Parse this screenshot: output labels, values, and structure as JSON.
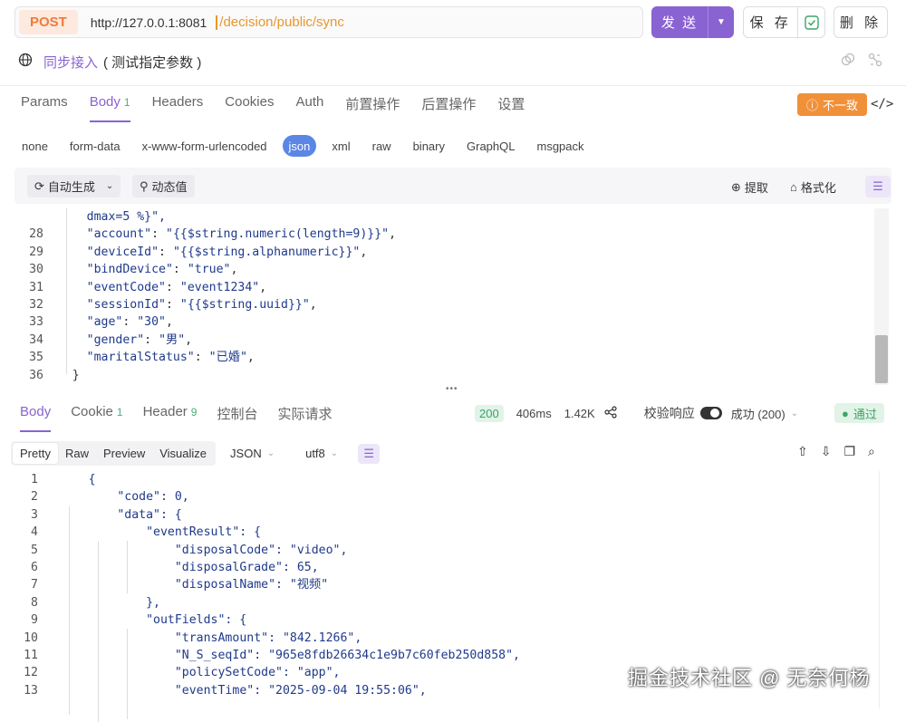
{
  "request": {
    "method": "POST",
    "url_host": "http://127.0.0.1:8081",
    "url_path": "/decision/public/sync",
    "send_label": "发 送",
    "save_label": "保 存",
    "delete_label": "删 除"
  },
  "title": {
    "name": "同步接入",
    "suffix": "( 测试指定参数 )"
  },
  "req_tabs": {
    "params": "Params",
    "body": "Body",
    "body_count": "1",
    "headers": "Headers",
    "cookies": "Cookies",
    "auth": "Auth",
    "pre": "前置操作",
    "post": "后置操作",
    "settings": "设置",
    "mismatch": "不一致"
  },
  "body_types": [
    "none",
    "form-data",
    "x-www-form-urlencoded",
    "json",
    "xml",
    "raw",
    "binary",
    "GraphQL",
    "msgpack"
  ],
  "body_type_active": "json",
  "editor_toolbar": {
    "auto": "自动生成",
    "dynamic": "动态值",
    "extract": "提取",
    "format": "格式化"
  },
  "request_body": {
    "partial": "dmax=5 %}\",",
    "lines": [
      {
        "n": "28",
        "key": "\"account\"",
        "val": "\"{{$string.numeric(length=9)}}\""
      },
      {
        "n": "29",
        "key": "\"deviceId\"",
        "val": "\"{{$string.alphanumeric}}\""
      },
      {
        "n": "30",
        "key": "\"bindDevice\"",
        "val": "\"true\""
      },
      {
        "n": "31",
        "key": "\"eventCode\"",
        "val": "\"event1234\""
      },
      {
        "n": "32",
        "key": "\"sessionId\"",
        "val": "\"{{$string.uuid}}\""
      },
      {
        "n": "33",
        "key": "\"age\"",
        "val": "\"30\""
      },
      {
        "n": "34",
        "key": "\"gender\"",
        "val": "\"男\""
      },
      {
        "n": "35",
        "key": "\"maritalStatus\"",
        "val": "\"已婚\""
      }
    ],
    "last_n": "36",
    "last": "}"
  },
  "res_tabs": {
    "body": "Body",
    "cookie": "Cookie",
    "cookie_count": "1",
    "header": "Header",
    "header_count": "9",
    "console": "控制台",
    "actual": "实际请求"
  },
  "res_status": {
    "code": "200",
    "time": "406ms",
    "size": "1.42K",
    "validate": "校验响应",
    "result": "成功 (200)",
    "pass": "通过"
  },
  "view_modes": {
    "pretty": "Pretty",
    "raw": "Raw",
    "preview": "Preview",
    "visualize": "Visualize",
    "format": "JSON",
    "encoding": "utf8"
  },
  "response_body": [
    {
      "n": "1",
      "t": "{"
    },
    {
      "n": "2",
      "t": "\"code\": 0,"
    },
    {
      "n": "3",
      "t": "\"data\": {"
    },
    {
      "n": "4",
      "t": "\"eventResult\": {"
    },
    {
      "n": "5",
      "t": "\"disposalCode\": \"video\","
    },
    {
      "n": "6",
      "t": "\"disposalGrade\": 65,"
    },
    {
      "n": "7",
      "t": "\"disposalName\": \"视频\""
    },
    {
      "n": "8",
      "t": "},"
    },
    {
      "n": "9",
      "t": "\"outFields\": {"
    },
    {
      "n": "10",
      "t": "\"transAmount\": \"842.1266\","
    },
    {
      "n": "11",
      "t": "\"N_S_seqId\": \"965e8fdb26634c1e9b7c60feb250d858\","
    },
    {
      "n": "12",
      "t": "\"policySetCode\": \"app\","
    },
    {
      "n": "13",
      "t": "\"eventTime\": \"2025-09-04 19:55:06\","
    }
  ],
  "watermark": "掘金技术社区 @ 无奈何杨"
}
